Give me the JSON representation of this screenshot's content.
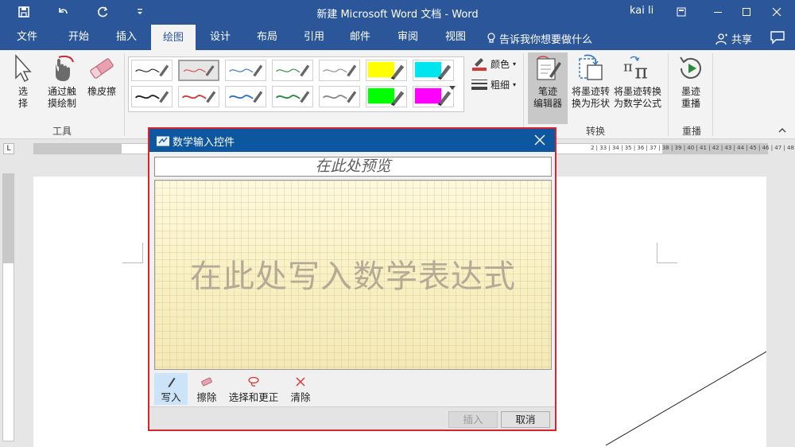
{
  "window": {
    "title": "新建 Microsoft Word 文档  -  Word",
    "user": "kai li"
  },
  "tabs": [
    {
      "label": "文件"
    },
    {
      "label": "开始"
    },
    {
      "label": "插入"
    },
    {
      "label": "绘图"
    },
    {
      "label": "设计"
    },
    {
      "label": "布局"
    },
    {
      "label": "引用"
    },
    {
      "label": "邮件"
    },
    {
      "label": "审阅"
    },
    {
      "label": "视图"
    }
  ],
  "active_tab": "绘图",
  "tell_me": "告诉我你想要做什么",
  "share": "共享",
  "ribbon": {
    "tools": {
      "select": "选\n择",
      "touch_draw": "通过触\n摸绘制",
      "eraser": "橡皮擦",
      "label": "工具"
    },
    "pens": {
      "colors": [
        "#222222",
        "#d23a3a",
        "#2f72c2",
        "#2a8a3e",
        "#8a8a8a",
        "#ffff00",
        "#00e5ee",
        "#222222",
        "#d23a3a",
        "#2f72c2",
        "#2a8a3e",
        "#8a8a8a",
        "#00ff00",
        "#ff00ff"
      ],
      "color_label": "颜色",
      "thickness_label": "粗细"
    },
    "convert": {
      "ink_editor": "笔迹\n编辑器",
      "ink_to_shape": "将墨迹转\n换为形状",
      "ink_to_math": "将墨迹转换\n为数学公式",
      "label": "转换"
    },
    "replay": {
      "ink_replay": "墨迹\n重播",
      "label": "重播"
    }
  },
  "ruler": {
    "ticks": "2 | 33 | 34 | 35 | 36 | 37 | 38 | 39 | 40 | 41 | 42 | 43 | 44 | 45 | 46 | 47 | 48"
  },
  "dialog": {
    "title": "数学输入控件",
    "preview_placeholder": "在此处预览",
    "write_hint": "在此处写入数学表达式",
    "tools": [
      {
        "label": "写入",
        "icon": "pen-icon"
      },
      {
        "label": "擦除",
        "icon": "eraser-icon"
      },
      {
        "label": "选择和更正",
        "icon": "lasso-icon"
      },
      {
        "label": "清除",
        "icon": "clear-icon"
      }
    ],
    "active_tool": "写入",
    "insert_label": "插入",
    "cancel_label": "取消"
  }
}
